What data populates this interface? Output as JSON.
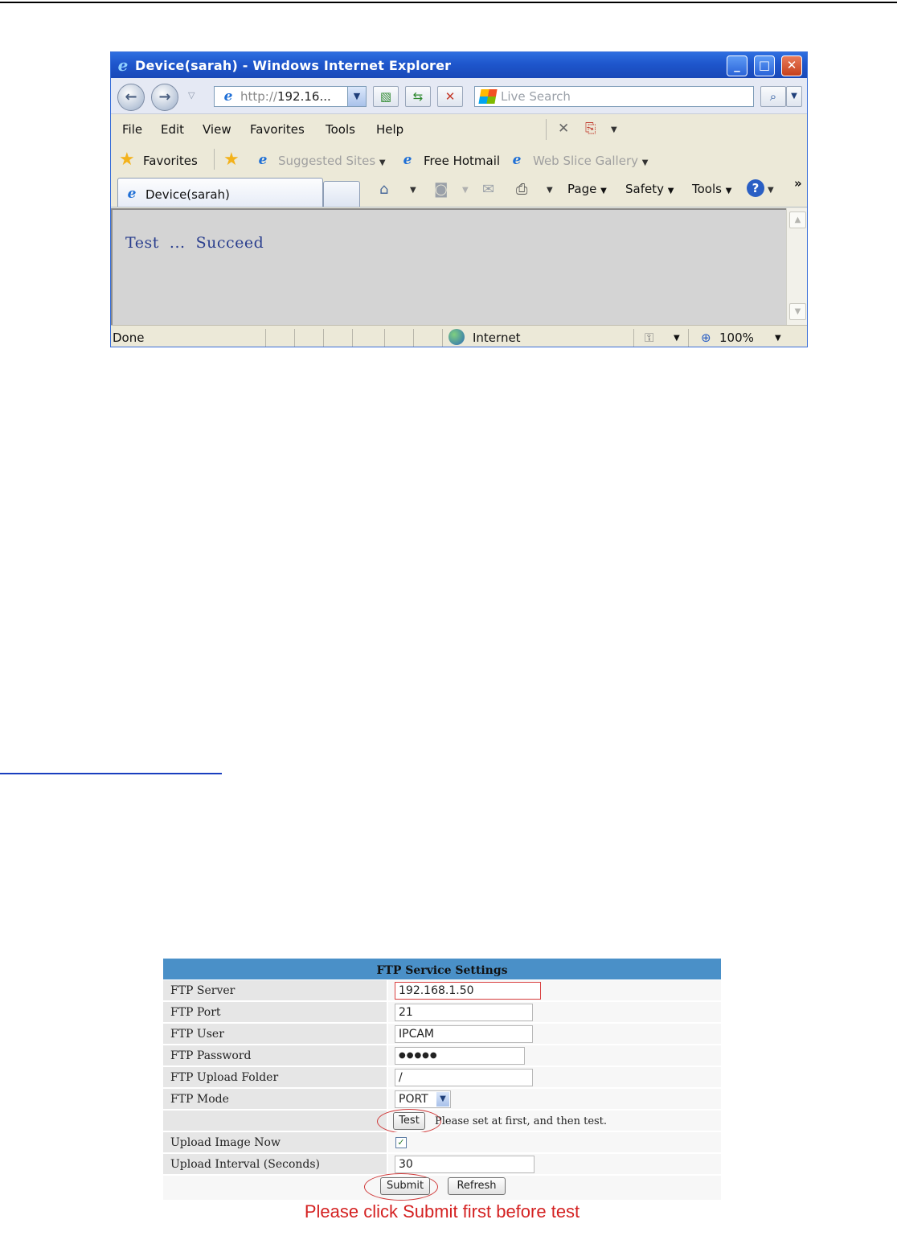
{
  "browser": {
    "title": "Device(sarah) - Windows Internet Explorer",
    "address": {
      "prefix": "http://",
      "rest": "192.16..."
    },
    "search_placeholder": "Live Search",
    "menu": [
      "File",
      "Edit",
      "View",
      "Favorites",
      "Tools",
      "Help"
    ],
    "favorites": {
      "label": "Favorites",
      "suggested": "Suggested Sites",
      "hotmail": "Free Hotmail",
      "webslice": "Web Slice Gallery"
    },
    "tab_label": "Device(sarah)",
    "commands": {
      "page": "Page",
      "safety": "Safety",
      "tools": "Tools",
      "more": "»"
    },
    "content_message": "Test  ...  Succeed",
    "status": {
      "left": "Done",
      "zone": "Internet",
      "zoom": "100%"
    }
  },
  "ftp": {
    "header": "FTP Service Settings",
    "rows": [
      {
        "label": "FTP Server",
        "value": "192.168.1.50"
      },
      {
        "label": "FTP Port",
        "value": "21"
      },
      {
        "label": "FTP User",
        "value": "IPCAM"
      },
      {
        "label": "FTP Password",
        "value": "●●●●●"
      },
      {
        "label": "FTP Upload Folder",
        "value": "/"
      },
      {
        "label": "FTP Mode",
        "value": "PORT"
      }
    ],
    "test_button": "Test",
    "test_hint": "Please set at first, and then test.",
    "upload_now_label": "Upload Image Now",
    "upload_now_checked": true,
    "interval_label": "Upload Interval (Seconds)",
    "interval_value": "30",
    "submit_button": "Submit",
    "refresh_button": "Refresh"
  },
  "annotation": "Please click Submit first before test",
  "colors": {
    "ftp_header": "#4a90c8",
    "annotation": "#d42222",
    "title_bar": "#2360d4"
  }
}
